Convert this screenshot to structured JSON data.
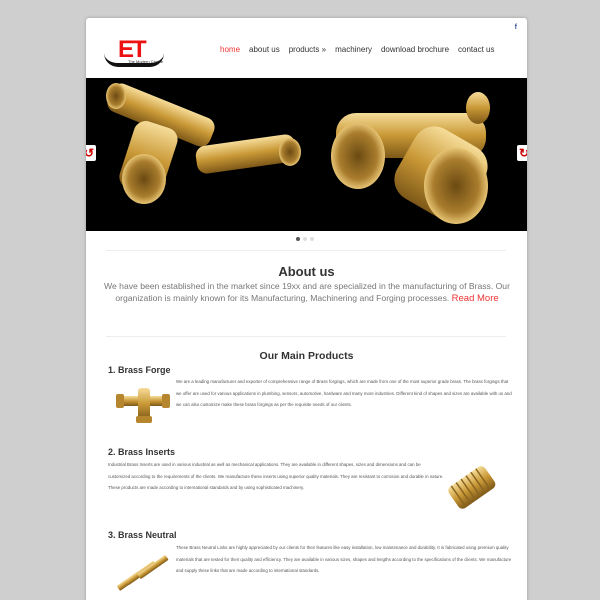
{
  "header": {
    "facebook_label": "f",
    "logo_text": "ET",
    "logo_tagline": "The Modern Choice"
  },
  "nav": {
    "items": [
      "home",
      "about us",
      "products »",
      "machinery",
      "download brochure",
      "contact us"
    ],
    "active_index": 0
  },
  "slider": {
    "prev_label": "↺",
    "next_label": "↻",
    "slide_count": 3,
    "active_slide": 1
  },
  "about": {
    "heading": "About us",
    "text": "We have been established in the market since 19xx and are specialized in the manufacturing of Brass. Our organization is mainly known for its Manufacturing, Machinering and Forging processes.",
    "read_more": "Read More"
  },
  "products": {
    "heading": "Our Main Products",
    "items": [
      {
        "title": "1. Brass Forge",
        "description": "We are a leading manufacturer and exporter of comprehensive range of Brass forgings, which are made from one of the most superior grade brass. The brass forgings that we offer are used for various applications in plumbing, sensors, automotive, hardware and many more industries. Different kind of shapes and sizes are available with us and we can also customize make these brass forgings as per the requisite needs of our clients."
      },
      {
        "title": "2. Brass Inserts",
        "description": "Industrial Brass Inserts are used in various industrial as well as mechanical applications. They are available in different shapes, sizes and dimensions and can be customized according to the requirements of the clients. We manufacture these inserts using superior quality materials. They are resistant to corrosion and durable in nature. These products are made according to international standards and by using sophisticated machinery."
      },
      {
        "title": "3. Brass Neutral",
        "description": "These Brass Neutral Links are highly appreciated by our clients for their features like easy installation, low maintenance and durability. It is fabricated using premium quality materials that are tested for their quality and efficiency. They are available in various sizes, shapes and lengths according to the specifications of the clients. We manufacture and supply these links that are made according to international standards."
      }
    ]
  },
  "colors": {
    "accent": "#e33333",
    "brass": "#d4a84a",
    "page_bg": "#cfcfcf"
  }
}
